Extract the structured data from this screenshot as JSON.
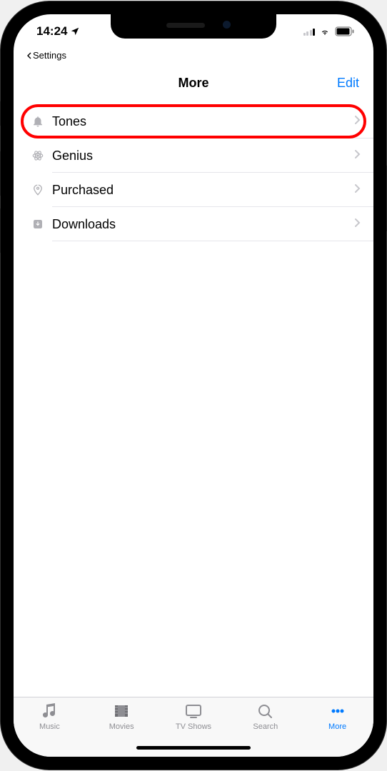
{
  "status": {
    "time": "14:24",
    "back_app_label": "Settings"
  },
  "nav": {
    "title": "More",
    "edit_label": "Edit"
  },
  "list": {
    "items": [
      {
        "label": "Tones",
        "icon": "bell-icon",
        "highlighted": true
      },
      {
        "label": "Genius",
        "icon": "atom-icon",
        "highlighted": false
      },
      {
        "label": "Purchased",
        "icon": "tag-icon",
        "highlighted": false
      },
      {
        "label": "Downloads",
        "icon": "download-icon",
        "highlighted": false
      }
    ]
  },
  "tabs": {
    "items": [
      {
        "label": "Music",
        "icon": "music-icon",
        "active": false
      },
      {
        "label": "Movies",
        "icon": "film-icon",
        "active": false
      },
      {
        "label": "TV Shows",
        "icon": "tv-icon",
        "active": false
      },
      {
        "label": "Search",
        "icon": "search-icon",
        "active": false
      },
      {
        "label": "More",
        "icon": "more-icon",
        "active": true
      }
    ]
  }
}
